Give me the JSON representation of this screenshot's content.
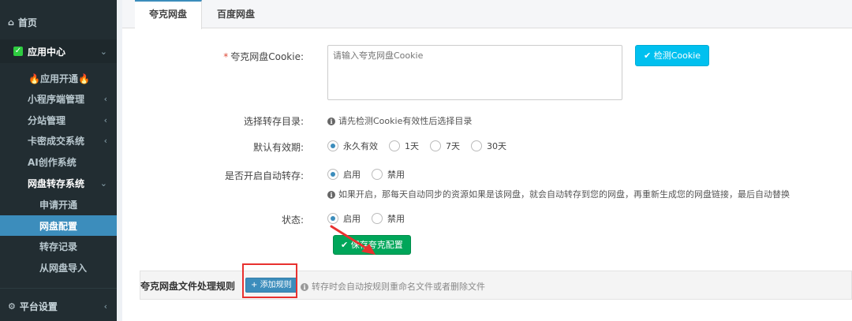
{
  "sidebar": {
    "home": "首页",
    "app_center": "应用中心",
    "items": [
      {
        "label": "🔥应用开通🔥"
      },
      {
        "label": "小程序端管理"
      },
      {
        "label": "分站管理"
      },
      {
        "label": "卡密成交系统"
      },
      {
        "label": "AI创作系统"
      },
      {
        "label": "网盘转存系统"
      }
    ],
    "subitems": [
      {
        "label": "申请开通"
      },
      {
        "label": "网盘配置"
      },
      {
        "label": "转存记录"
      },
      {
        "label": "从网盘导入"
      }
    ],
    "platform": "平台设置"
  },
  "tabs": [
    {
      "label": "夸克网盘"
    },
    {
      "label": "百度网盘"
    }
  ],
  "form": {
    "cookie_label": "夸克网盘Cookie:",
    "cookie_placeholder": "请输入夸克网盘Cookie",
    "check_cookie_button": "检测Cookie",
    "dir_label": "选择转存目录:",
    "dir_info": "请先检测Cookie有效性后选择目录",
    "validity_label": "默认有效期:",
    "validity_options": [
      "永久有效",
      "1天",
      "7天",
      "30天"
    ],
    "auto_label": "是否开启自动转存:",
    "auto_options": [
      "启用",
      "禁用"
    ],
    "auto_info": "如果开启，那每天自动同步的资源如果是该网盘，就会自动转存到您的网盘，再重新生成您的网盘链接，最后自动替换",
    "status_label": "状态:",
    "status_options": [
      "启用",
      "禁用"
    ],
    "save_button": "保存夸克配置"
  },
  "rules": {
    "title": "夸克网盘文件处理规则",
    "add_button": "添加规则",
    "hint": "转存时会自动按规则重命名文件或者删除文件"
  },
  "colors": {
    "sidebar_bg": "#222d32",
    "active": "#3c8dbc",
    "info_button": "#00c0ef",
    "success_button": "#00a65a",
    "highlight": "#e8312f"
  }
}
